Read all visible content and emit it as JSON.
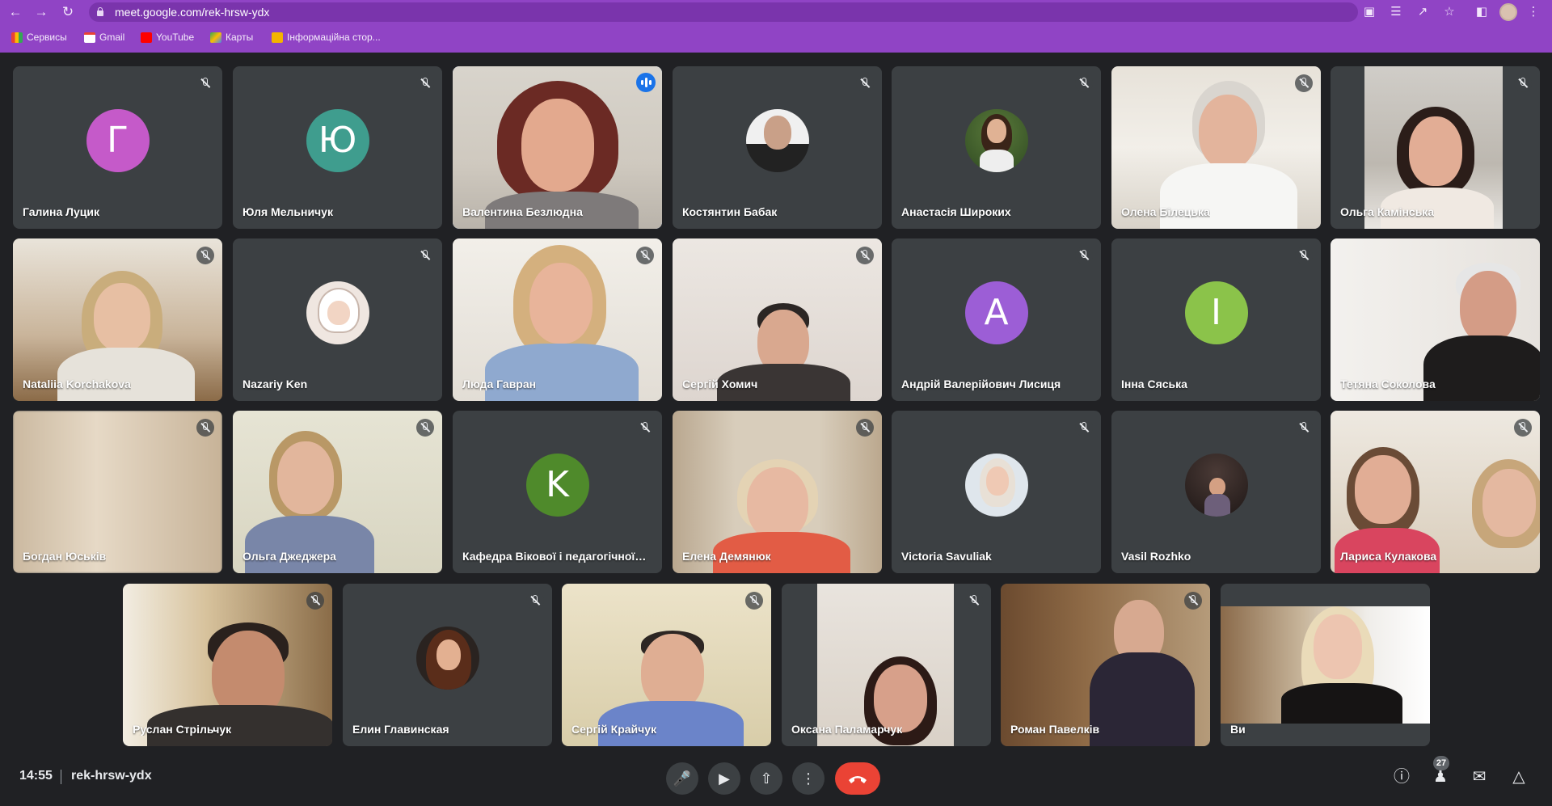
{
  "browser": {
    "url": "meet.google.com/rek-hrsw-ydx",
    "bookmarks": [
      "Сервисы",
      "Gmail",
      "YouTube",
      "Карты",
      "Інформаційна стор..."
    ]
  },
  "participants": [
    {
      "name": "Галина Луцик",
      "avatar_letter": "Г",
      "avatar_color": "#c55ac9"
    },
    {
      "name": "Юля Мельничук",
      "avatar_letter": "Ю",
      "avatar_color": "#3f9d8e"
    },
    {
      "name": "Валентина Безлюдна",
      "speaking": true
    },
    {
      "name": "Костянтин Бабак"
    },
    {
      "name": "Анастасія Широких"
    },
    {
      "name": "Олена Білецька"
    },
    {
      "name": "Ольга Камінська"
    },
    {
      "name": "Nataliia Korchakova"
    },
    {
      "name": "Nazariy Ken"
    },
    {
      "name": "Люда Гавран"
    },
    {
      "name": "Сергій Хомич"
    },
    {
      "name": "Андрій Валерійович Лисиця",
      "avatar_letter": "A",
      "avatar_color": "#9c5ed6"
    },
    {
      "name": "Інна Сяська",
      "avatar_letter": "I",
      "avatar_color": "#8bc34a"
    },
    {
      "name": "Тетяна Соколова"
    },
    {
      "name": "Богдан Юськів"
    },
    {
      "name": "Ольга Джеджера"
    },
    {
      "name": "Кафедра Вікової і педагогічної п...",
      "avatar_letter": "K",
      "avatar_color": "#4f8a2b"
    },
    {
      "name": "Елена Демянюк"
    },
    {
      "name": "Victoria Savuliak"
    },
    {
      "name": "Vasil Rozhko"
    },
    {
      "name": "Лариса Кулакова"
    },
    {
      "name": "Руслан Стрільчук"
    },
    {
      "name": "Елин Главинская"
    },
    {
      "name": "Сергій Крайчук"
    },
    {
      "name": "Оксана Паламарчук"
    },
    {
      "name": "Роман Павелків"
    },
    {
      "name": "Ви"
    }
  ],
  "bottom_bar": {
    "time": "14:55",
    "meeting_code": "rek-hrsw-ydx",
    "participants_count": "27"
  },
  "colors": {
    "chrome": "#9044c5",
    "background": "#202124",
    "tile": "#3c4043",
    "end_call": "#ea4335",
    "speaking": "#1a73e8"
  }
}
